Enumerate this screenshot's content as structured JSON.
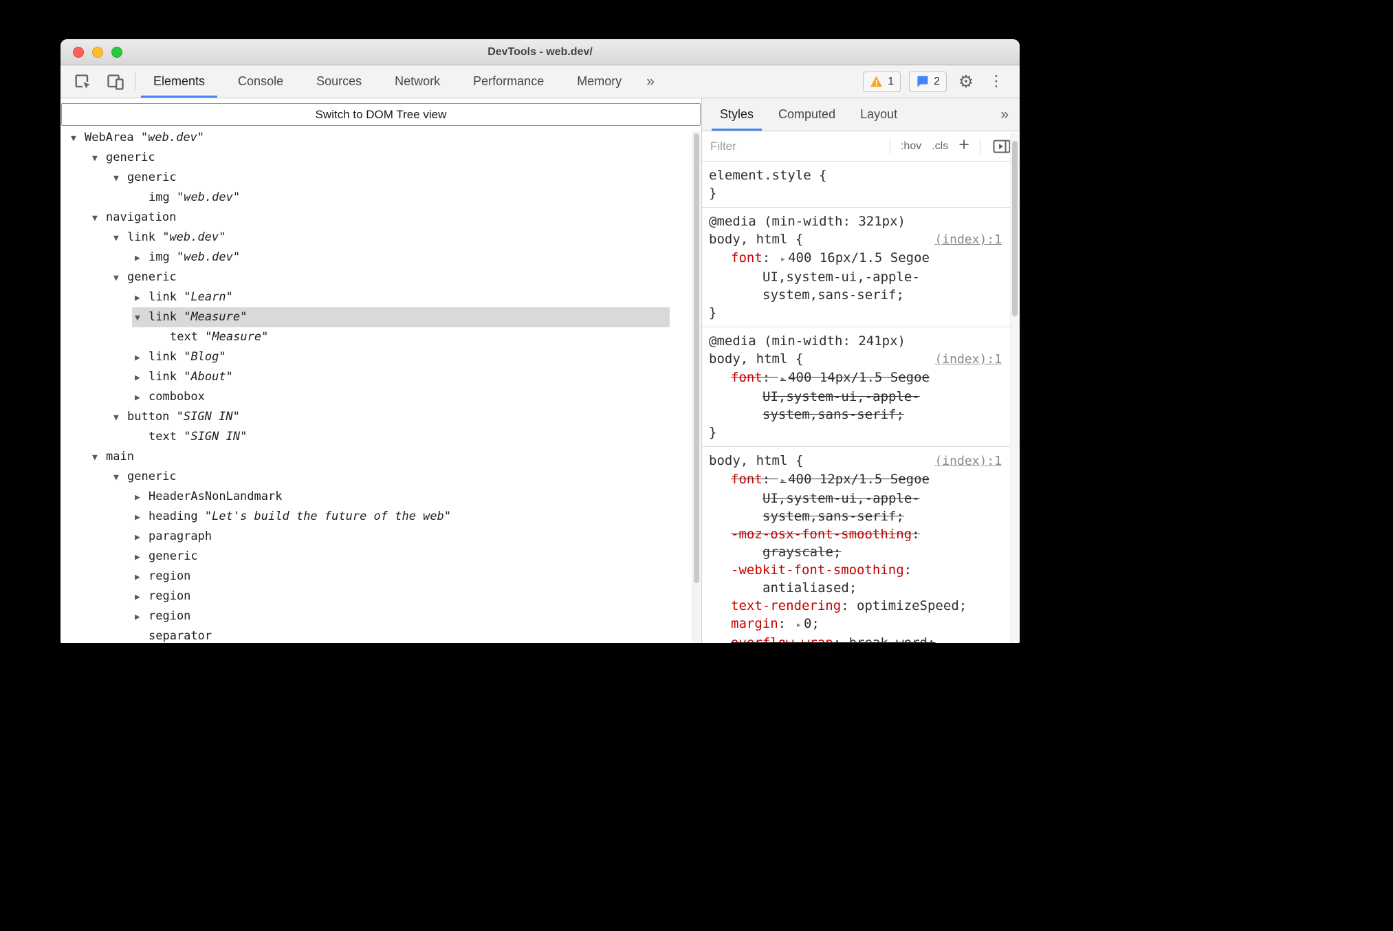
{
  "window": {
    "title": "DevTools - web.dev/"
  },
  "main_toolbar": {
    "tabs": [
      {
        "label": "Elements",
        "active": true
      },
      {
        "label": "Console",
        "active": false
      },
      {
        "label": "Sources",
        "active": false
      },
      {
        "label": "Network",
        "active": false
      },
      {
        "label": "Performance",
        "active": false
      },
      {
        "label": "Memory",
        "active": false
      }
    ],
    "more_tabs": "»",
    "warning_badge": "1",
    "message_badge": "2"
  },
  "icons": {
    "gear": "⚙",
    "kebab": "⋮"
  },
  "elements_panel": {
    "infobar_label": "Switch to DOM Tree view",
    "tree": [
      {
        "level": 0,
        "arrow": "down",
        "role": "WebArea",
        "name": "web.dev"
      },
      {
        "level": 1,
        "arrow": "down",
        "role": "generic"
      },
      {
        "level": 2,
        "arrow": "down",
        "role": "generic"
      },
      {
        "level": 3,
        "arrow": "none",
        "role": "img",
        "name": "web.dev"
      },
      {
        "level": 1,
        "arrow": "down",
        "role": "navigation"
      },
      {
        "level": 2,
        "arrow": "down",
        "role": "link",
        "name": "web.dev"
      },
      {
        "level": 3,
        "arrow": "right",
        "role": "img",
        "name": "web.dev"
      },
      {
        "level": 2,
        "arrow": "down",
        "role": "generic"
      },
      {
        "level": 3,
        "arrow": "right",
        "role": "link",
        "name": "Learn"
      },
      {
        "level": 3,
        "arrow": "down",
        "role": "link",
        "name": "Measure",
        "selected": true
      },
      {
        "level": 4,
        "arrow": "none",
        "role": "text",
        "name": "Measure"
      },
      {
        "level": 3,
        "arrow": "right",
        "role": "link",
        "name": "Blog"
      },
      {
        "level": 3,
        "arrow": "right",
        "role": "link",
        "name": "About"
      },
      {
        "level": 3,
        "arrow": "right",
        "role": "combobox"
      },
      {
        "level": 2,
        "arrow": "down",
        "role": "button",
        "name": "SIGN IN"
      },
      {
        "level": 3,
        "arrow": "none",
        "role": "text",
        "name": "SIGN IN"
      },
      {
        "level": 1,
        "arrow": "down",
        "role": "main"
      },
      {
        "level": 2,
        "arrow": "down",
        "role": "generic"
      },
      {
        "level": 3,
        "arrow": "right",
        "role": "HeaderAsNonLandmark"
      },
      {
        "level": 3,
        "arrow": "right",
        "role": "heading",
        "name": "Let's build the future of the web"
      },
      {
        "level": 3,
        "arrow": "right",
        "role": "paragraph"
      },
      {
        "level": 3,
        "arrow": "right",
        "role": "generic"
      },
      {
        "level": 3,
        "arrow": "right",
        "role": "region"
      },
      {
        "level": 3,
        "arrow": "right",
        "role": "region"
      },
      {
        "level": 3,
        "arrow": "right",
        "role": "region"
      },
      {
        "level": 3,
        "arrow": "none",
        "role": "separator"
      }
    ]
  },
  "styles_panel": {
    "tabs": [
      {
        "label": "Styles",
        "active": true
      },
      {
        "label": "Computed",
        "active": false
      },
      {
        "label": "Layout",
        "active": false
      }
    ],
    "more_tabs": "»",
    "filter_placeholder": "Filter",
    "pseudo_toggle": ":hov",
    "class_toggle": ".cls",
    "new_rule": "+",
    "sections": [
      {
        "selector": "element.style {",
        "close": "}"
      },
      {
        "at_rule": "@media (min-width: 321px)",
        "selector": "body, html {",
        "link": "(index):1",
        "properties": [
          {
            "name": "font",
            "arrow": true,
            "value": "400 16px/1.5 Segoe UI,system-ui,-apple-system,sans-serif;",
            "struck": false
          }
        ],
        "close": "}"
      },
      {
        "at_rule": "@media (min-width: 241px)",
        "selector": "body, html {",
        "link": "(index):1",
        "properties": [
          {
            "name": "font",
            "arrow": true,
            "value": "400 14px/1.5 Segoe UI,system-ui,-apple-system,sans-serif;",
            "struck": true
          }
        ],
        "close": "}"
      },
      {
        "selector": "body, html {",
        "link": "(index):1",
        "properties": [
          {
            "name": "font",
            "arrow": true,
            "value": "400 12px/1.5 Segoe UI,system-ui,-apple-system,sans-serif;",
            "struck": true
          },
          {
            "name": "-moz-osx-font-smoothing",
            "value": "grayscale;",
            "struck": true
          },
          {
            "name": "-webkit-font-smoothing",
            "value": "antialiased;",
            "struck": false
          },
          {
            "name": "text-rendering",
            "value": "optimizeSpeed;",
            "struck": false
          },
          {
            "name": "margin",
            "arrow": true,
            "value": "0;",
            "struck": false
          },
          {
            "name": "overflow-wrap",
            "value": "break-word;",
            "struck": true
          }
        ],
        "close": "}"
      }
    ]
  },
  "colors": {
    "accent_blue": "#4285f4",
    "property_red": "#c80000",
    "selection_gray": "#d9d9d9",
    "warning_yellow": "#f5a623",
    "bubble_blue": "#4285f4",
    "traffic_red": "#ff5f57",
    "traffic_yellow": "#febc2e",
    "traffic_green": "#28c840"
  }
}
